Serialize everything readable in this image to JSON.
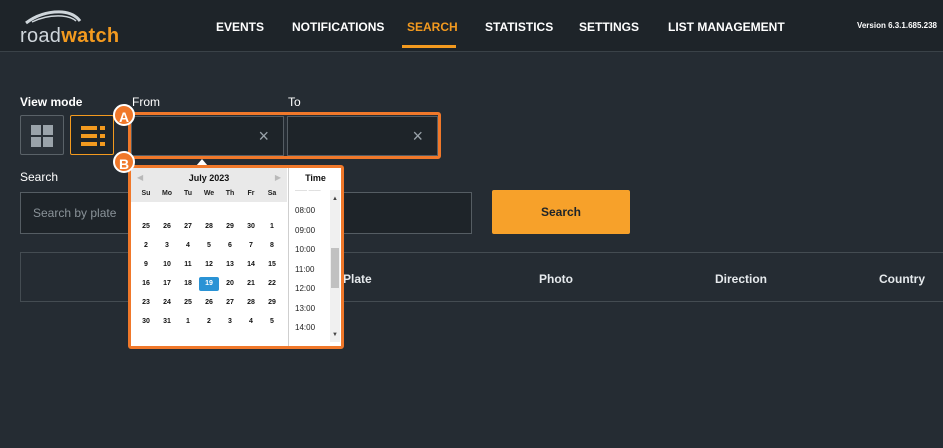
{
  "header": {
    "logo": {
      "part1": "road",
      "part2": "watch"
    },
    "nav": [
      "EVENTS",
      "NOTIFICATIONS",
      "SEARCH",
      "STATISTICS",
      "SETTINGS",
      "LIST MANAGEMENT"
    ],
    "active_nav": "SEARCH",
    "version": "Version 6.3.1.685.238"
  },
  "filters": {
    "view_mode_label": "View mode",
    "from_label": "From",
    "to_label": "To",
    "from_value": "",
    "to_value": "",
    "clear_icon": "×"
  },
  "callouts": [
    "A",
    "B"
  ],
  "search": {
    "label": "Search",
    "placeholder": "Search by plate",
    "button": "Search"
  },
  "table": {
    "columns": [
      "Plate",
      "Photo",
      "Direction",
      "Country"
    ]
  },
  "datepicker": {
    "month_title": "July 2023",
    "weekdays": [
      "Su",
      "Mo",
      "Tu",
      "We",
      "Th",
      "Fr",
      "Sa"
    ],
    "weeks": [
      [
        "25",
        "26",
        "27",
        "28",
        "29",
        "30",
        "1"
      ],
      [
        "2",
        "3",
        "4",
        "5",
        "6",
        "7",
        "8"
      ],
      [
        "9",
        "10",
        "11",
        "12",
        "13",
        "14",
        "15"
      ],
      [
        "16",
        "17",
        "18",
        "19",
        "20",
        "21",
        "22"
      ],
      [
        "23",
        "24",
        "25",
        "26",
        "27",
        "28",
        "29"
      ],
      [
        "30",
        "31",
        "1",
        "2",
        "3",
        "4",
        "5"
      ]
    ],
    "selected_day": "19",
    "time_label": "Time",
    "times": [
      "08:00",
      "09:00",
      "10:00",
      "11:00",
      "12:00",
      "13:00",
      "14:00"
    ],
    "accent": "#2a93d5"
  },
  "colors": {
    "accent": "#f39a1f",
    "callout": "#f0782a",
    "background": "#252c33"
  }
}
